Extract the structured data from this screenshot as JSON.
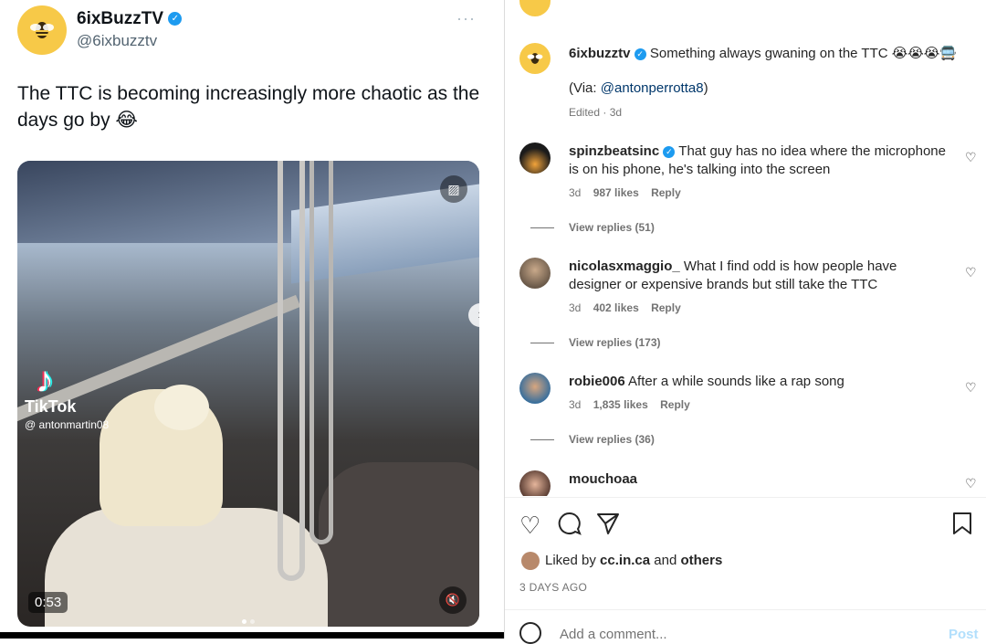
{
  "tweet": {
    "name": "6ixBuzzTV",
    "handle": "@6ixbuzztv",
    "more": "···",
    "text": "The TTC is becoming increasingly more chaotic as the days go by 😂",
    "video": {
      "watermark_brand": "TikTok",
      "watermark_user": "@ antonmartin08",
      "duration": "0:53",
      "next_icon": "›"
    }
  },
  "post": {
    "top_more": "···",
    "author": "6ixbuzztv",
    "caption": "Something always gwaning on the TTC 😭😭😭🚍",
    "via_prefix": "(Via: ",
    "via_link": "@antonperrotta8",
    "via_suffix": ")",
    "edited": "Edited · 3d",
    "comments": [
      {
        "user": "spinzbeatsinc",
        "verified": true,
        "text": "That guy has no idea where the microphone is on his phone, he's talking into the screen",
        "age": "3d",
        "likes": "987 likes",
        "reply": "Reply",
        "view_replies": "View replies (51)"
      },
      {
        "user": "nicolasxmaggio_",
        "verified": false,
        "text": "What I find odd is how people have designer or expensive brands but still take the TTC",
        "age": "3d",
        "likes": "402 likes",
        "reply": "Reply",
        "view_replies": "View replies (173)"
      },
      {
        "user": "robie006",
        "verified": false,
        "text": "After a while sounds like a rap song",
        "age": "3d",
        "likes": "1,835 likes",
        "reply": "Reply",
        "view_replies": "View replies (36)"
      },
      {
        "user": "mouchoaa",
        "verified": false,
        "text": ""
      }
    ],
    "liked_by_prefix": "Liked by ",
    "liked_by_user": "cc.in.ca",
    "liked_by_and": " and ",
    "liked_by_others": "others",
    "time": "3 DAYS AGO",
    "add_comment_placeholder": "Add a comment...",
    "post_label": "Post"
  },
  "colors": {
    "verified": "#1d9bf0",
    "link": "#00376b",
    "muted": "#737373",
    "post_btn": "#b2dffc"
  }
}
